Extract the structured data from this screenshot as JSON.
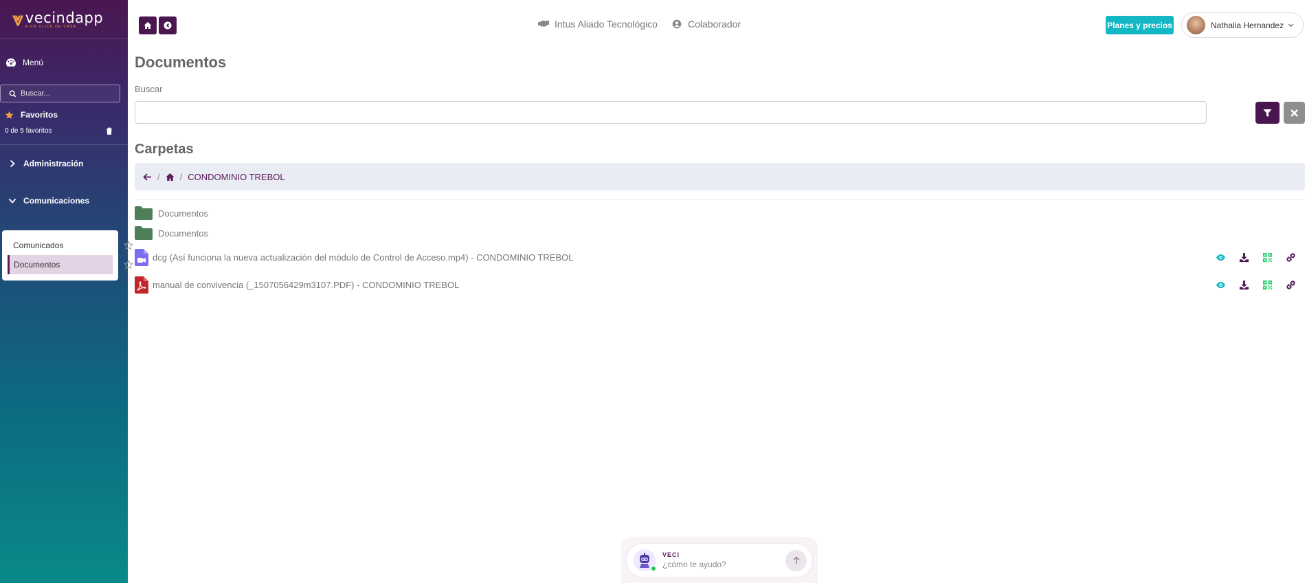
{
  "brand": {
    "name": "vecindapp",
    "tagline": "A UN CLICK DE CASA",
    "accent": "#f0a040"
  },
  "sidebar": {
    "menu_label": "Menú",
    "search_placeholder": "Buscar...",
    "favorites_label": "Favoritos",
    "favorites_count": "0 de 5 favoritos",
    "sections": [
      {
        "label": "Administración",
        "expanded": false
      },
      {
        "label": "Comunicaciones",
        "expanded": true
      }
    ],
    "submenu": [
      {
        "label": "Comunicados",
        "active": false
      },
      {
        "label": "Documentos",
        "active": true
      }
    ]
  },
  "header": {
    "links": [
      {
        "label": "Intus Aliado Tecnológico",
        "icon": "handshake-icon"
      },
      {
        "label": "Colaborador",
        "icon": "user-circle-icon"
      }
    ],
    "plans_label": "Planes y precios",
    "user_name": "Nathalia Hernandez"
  },
  "main": {
    "title": "Documentos",
    "search_label": "Buscar",
    "search_value": "",
    "folders_title": "Carpetas",
    "breadcrumb": [
      "CONDOMINIO TREBOL"
    ],
    "folders": [
      {
        "name": "Documentos"
      },
      {
        "name": "Documentos"
      }
    ],
    "files": [
      {
        "name": "dcg (Así funciona la nueva actualización del módulo de Control de Acceso.mp4) - CONDOMINIO TREBOL",
        "type": "video"
      },
      {
        "name": "manual de convivencia (_1507056429m3107.PDF) - CONDOMINIO TREBOL",
        "type": "pdf"
      }
    ]
  },
  "chat": {
    "label": "VECI",
    "placeholder": "¿cómo te ayudo?"
  },
  "colors": {
    "primary": "#4a1650",
    "teal": "#14b8c4",
    "folder": "#4f7f5a",
    "video": "#7b6cf0",
    "pdf": "#c0262a",
    "view": "#14b8c4",
    "qr": "#2ecc71"
  }
}
